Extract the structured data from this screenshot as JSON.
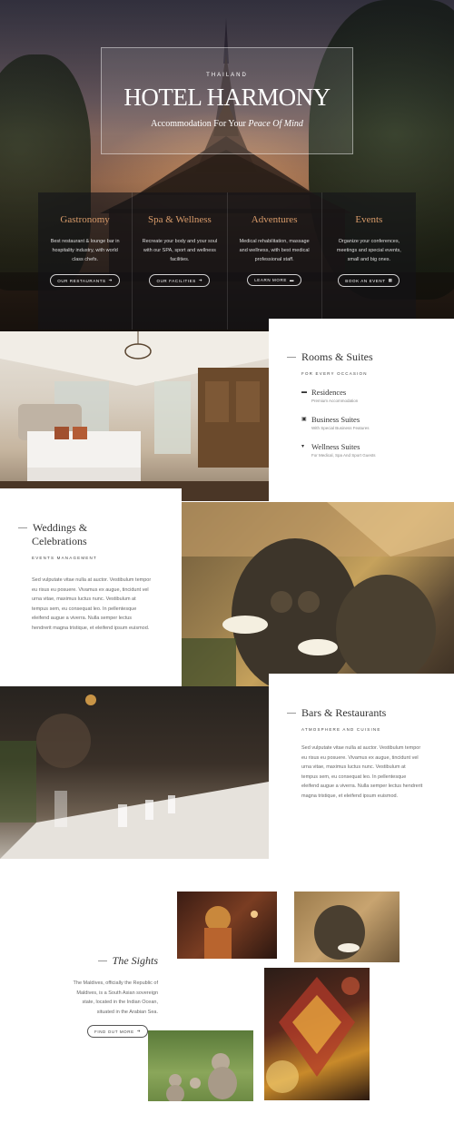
{
  "hero": {
    "eyebrow": "THAILAND",
    "title": "HOTEL HARMONY",
    "subtitle_prefix": "Accommodation For Your",
    "subtitle_emphasis": "Peace Of Mind"
  },
  "features": [
    {
      "title": "Gastronomy",
      "desc": "Best restaurant & lounge bar in hospitality industry, with world class chefs.",
      "button": "OUR RESTAURANTS",
      "icon": "arrow-right-icon"
    },
    {
      "title": "Spa & Wellness",
      "desc": "Recreate your body and your soul with our SPA, sport and wellness facilities.",
      "button": "OUR FACILITIES",
      "icon": "arrow-right-icon"
    },
    {
      "title": "Adventures",
      "desc": "Medical rehabilitation, massage and wellness, with best medical professional staff.",
      "button": "LEARN MORE",
      "icon": "ticket-icon"
    },
    {
      "title": "Events",
      "desc": "Organize your conferences, meetings and special events, small and big ones.",
      "button": "BOOK AN EVENT",
      "icon": "calendar-icon"
    }
  ],
  "rooms": {
    "title": "Rooms & Suites",
    "subtitle": "FOR EVERY OCCASION",
    "items": [
      {
        "title": "Residences",
        "sub": "Premium Accommodation",
        "icon": "bed-icon"
      },
      {
        "title": "Business Suites",
        "sub": "With Special Business Features",
        "icon": "building-icon"
      },
      {
        "title": "Wellness Suites",
        "sub": "For Medical, Spa And Sport Guests",
        "icon": "glass-icon"
      }
    ]
  },
  "weddings": {
    "title_line1": "Weddings &",
    "title_line2": "Celebrations",
    "subtitle": "EVENTS MANAGEMENT",
    "body": "Sed vulputate vitae nulla at auctor. Vestibulum tempor eu risus eu posuere. Vivamus ex augue, tincidunt vel urna vitae, maximus luctus nunc. Vestibulum at tempus sem, eu consequat leo. In pellentesque eleifend augue a viverra. Nulla semper lectus hendrerit magna tristique, et eleifend ipsum euismod."
  },
  "bars": {
    "title": "Bars & Restaurants",
    "subtitle": "ATMOSPHERE AND CUISINE",
    "body": "Sed vulputate vitae nulla at auctor. Vestibulum tempor eu risus eu posuere. Vivamus ex augue, tincidunt vel urna vitae, maximus luctus nunc. Vestibulum at tempus sem, eu consequat leo. In pellentesque eleifend augue a viverra. Nulla semper lectus hendrerit magna tristique, et eleifend ipsum euismod."
  },
  "sights": {
    "title": "The Sights",
    "body": "The Maldives, officially the Republic of Maldives, is a South Asian sovereign state, located in the Indian Ocean, situated in the Arabian Sea.",
    "button": "FIND OUT MORE"
  },
  "colors": {
    "accent": "#d89b6a",
    "heading": "#333333",
    "text": "#666666"
  }
}
